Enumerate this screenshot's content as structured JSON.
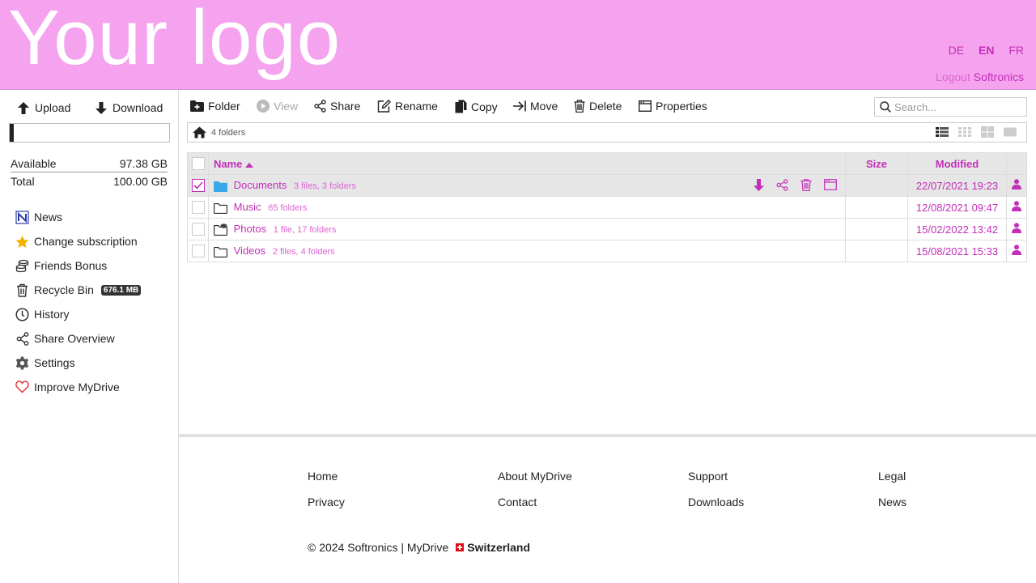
{
  "header": {
    "logo": "Your logo",
    "languages": [
      "DE",
      "EN",
      "FR"
    ],
    "active_language": "EN",
    "logout": "Logout",
    "user": "Softronics"
  },
  "sidebar": {
    "upload": "Upload",
    "download": "Download",
    "quota_fraction": 0.026,
    "available_label": "Available",
    "available_value": "97.38 GB",
    "total_label": "Total",
    "total_value": "100.00 GB",
    "items": [
      {
        "label": "News",
        "icon": "news-icon"
      },
      {
        "label": "Change subscription",
        "icon": "star-icon"
      },
      {
        "label": "Friends Bonus",
        "icon": "coins-icon"
      },
      {
        "label": "Recycle Bin",
        "icon": "trash-icon",
        "badge": "676.1 MB"
      },
      {
        "label": "History",
        "icon": "clock-icon"
      },
      {
        "label": "Share Overview",
        "icon": "share-icon"
      },
      {
        "label": "Settings",
        "icon": "gear-icon"
      },
      {
        "label": "Improve MyDrive",
        "icon": "heart-icon"
      }
    ]
  },
  "toolbar": {
    "folder": "Folder",
    "view": "View",
    "share": "Share",
    "rename": "Rename",
    "copy": "Copy",
    "move": "Move",
    "delete": "Delete",
    "properties": "Properties",
    "search_placeholder": "Search..."
  },
  "breadcrumb": {
    "count": "4 folders"
  },
  "table": {
    "columns": {
      "name": "Name",
      "size": "Size",
      "modified": "Modified"
    },
    "rows": [
      {
        "name": "Documents",
        "meta": "3 files, 3 folders",
        "size": "",
        "modified": "22/07/2021 19:23",
        "selected": true
      },
      {
        "name": "Music",
        "meta": "65 folders",
        "size": "",
        "modified": "12/08/2021 09:47",
        "selected": false
      },
      {
        "name": "Photos",
        "meta": "1 file, 17 folders",
        "size": "",
        "modified": "15/02/2022 13:42",
        "selected": false
      },
      {
        "name": "Videos",
        "meta": "2 files, 4 folders",
        "size": "",
        "modified": "15/08/2021 15:33",
        "selected": false
      }
    ]
  },
  "footer": {
    "links": [
      "Home",
      "About MyDrive",
      "Support",
      "Legal",
      "Privacy",
      "Contact",
      "Downloads",
      "News"
    ],
    "copyright": "© 2024 Softronics | MyDrive",
    "country": "Switzerland"
  },
  "colors": {
    "header_bg": "#f5a3ee",
    "accent": "#c22fb8",
    "folder_blue": "#3aa7e8"
  }
}
